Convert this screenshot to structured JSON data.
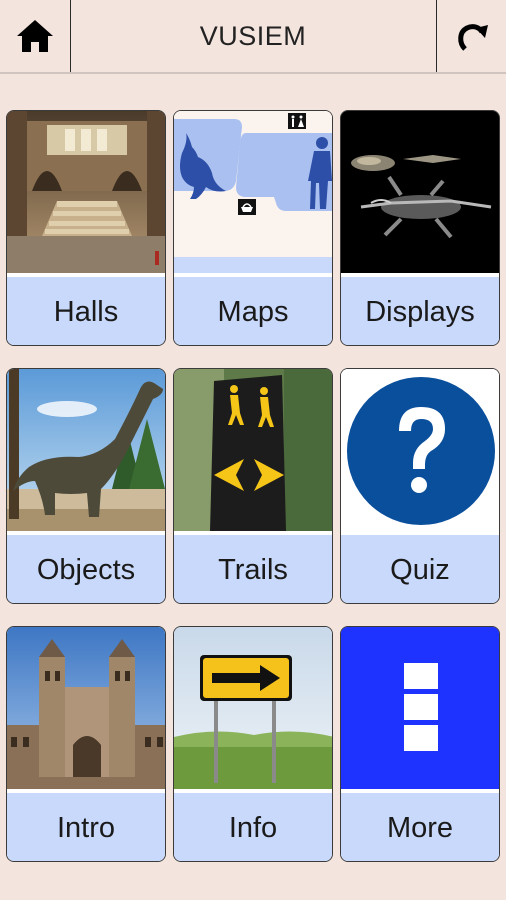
{
  "header": {
    "title": "VUSIEM",
    "home_icon": "home-icon",
    "refresh_icon": "refresh-icon"
  },
  "tiles": [
    {
      "label": "Halls",
      "image": "museum-hall-interior"
    },
    {
      "label": "Maps",
      "image": "museum-floor-map"
    },
    {
      "label": "Displays",
      "image": "fossil-skeletons"
    },
    {
      "label": "Objects",
      "image": "dinosaur-model"
    },
    {
      "label": "Trails",
      "image": "hiking-trail-post"
    },
    {
      "label": "Quiz",
      "image": "question-mark-icon"
    },
    {
      "label": "Intro",
      "image": "museum-building"
    },
    {
      "label": "Info",
      "image": "arrow-road-sign"
    },
    {
      "label": "More",
      "image": "more-menu-icon"
    }
  ],
  "colors": {
    "background": "#f3e4de",
    "label_bg": "#c9d9fb",
    "more_blue": "#1e33ff",
    "quiz_blue": "#0a4f9c"
  }
}
